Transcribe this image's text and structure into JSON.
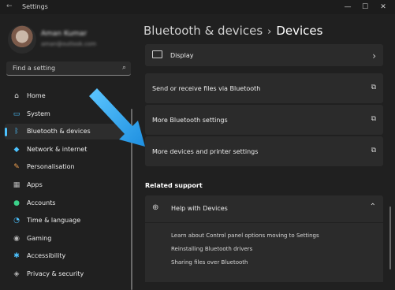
{
  "window": {
    "title": "Settings",
    "back_icon": "back-arrow-icon",
    "controls": {
      "minimize": "—",
      "maximize": "☐",
      "close": "✕"
    }
  },
  "user": {
    "name": "Aman Kumar",
    "email": "aman@outlook.com"
  },
  "search": {
    "placeholder": "Find a setting",
    "icon": "search-icon"
  },
  "sidebar": {
    "items": [
      {
        "label": "Home",
        "icon": "home-icon",
        "glyph": "⌂",
        "color": "#e6e6e6",
        "active": false
      },
      {
        "label": "System",
        "icon": "monitor-icon",
        "glyph": "▭",
        "color": "#4cc2ff",
        "active": false
      },
      {
        "label": "Bluetooth & devices",
        "icon": "bluetooth-icon",
        "glyph": "ᛒ",
        "color": "#4cc2ff",
        "active": true
      },
      {
        "label": "Network & internet",
        "icon": "wifi-icon",
        "glyph": "◆",
        "color": "#4cc2ff",
        "active": false
      },
      {
        "label": "Personalisation",
        "icon": "brush-icon",
        "glyph": "✎",
        "color": "#f0a050",
        "active": false
      },
      {
        "label": "Apps",
        "icon": "apps-icon",
        "glyph": "▦",
        "color": "#b8b8b8",
        "active": false
      },
      {
        "label": "Accounts",
        "icon": "person-icon",
        "glyph": "●",
        "color": "#3bd18a",
        "active": false
      },
      {
        "label": "Time & language",
        "icon": "globe-clock-icon",
        "glyph": "◔",
        "color": "#4cc2ff",
        "active": false
      },
      {
        "label": "Gaming",
        "icon": "gamepad-icon",
        "glyph": "◉",
        "color": "#b8b8b8",
        "active": false
      },
      {
        "label": "Accessibility",
        "icon": "accessibility-icon",
        "glyph": "✱",
        "color": "#4cc2ff",
        "active": false
      },
      {
        "label": "Privacy & security",
        "icon": "shield-icon",
        "glyph": "◈",
        "color": "#b8b8b8",
        "active": false
      }
    ]
  },
  "header": {
    "parent": "Bluetooth & devices",
    "separator": "›",
    "current": "Devices"
  },
  "cards": [
    {
      "label": "Display",
      "left_icon": "display-icon",
      "right_icon": "chevron-right-icon",
      "right_glyph": "›"
    },
    {
      "label": "Send or receive files via Bluetooth",
      "right_icon": "open-external-icon",
      "right_glyph": "⧉"
    },
    {
      "label": "More Bluetooth settings",
      "right_icon": "open-external-icon",
      "right_glyph": "⧉"
    },
    {
      "label": "More devices and printer settings",
      "right_icon": "open-external-icon",
      "right_glyph": "⧉"
    }
  ],
  "related_support": {
    "title": "Related support",
    "help": {
      "label": "Help with Devices",
      "icon": "globe-icon",
      "toggle_icon": "chevron-up-icon",
      "links": [
        "Learn about Control panel options moving to Settings",
        "Reinstalling Bluetooth drivers",
        "Sharing files over Bluetooth"
      ]
    }
  },
  "annotation": {
    "arrow_color": "#29a3f0"
  }
}
